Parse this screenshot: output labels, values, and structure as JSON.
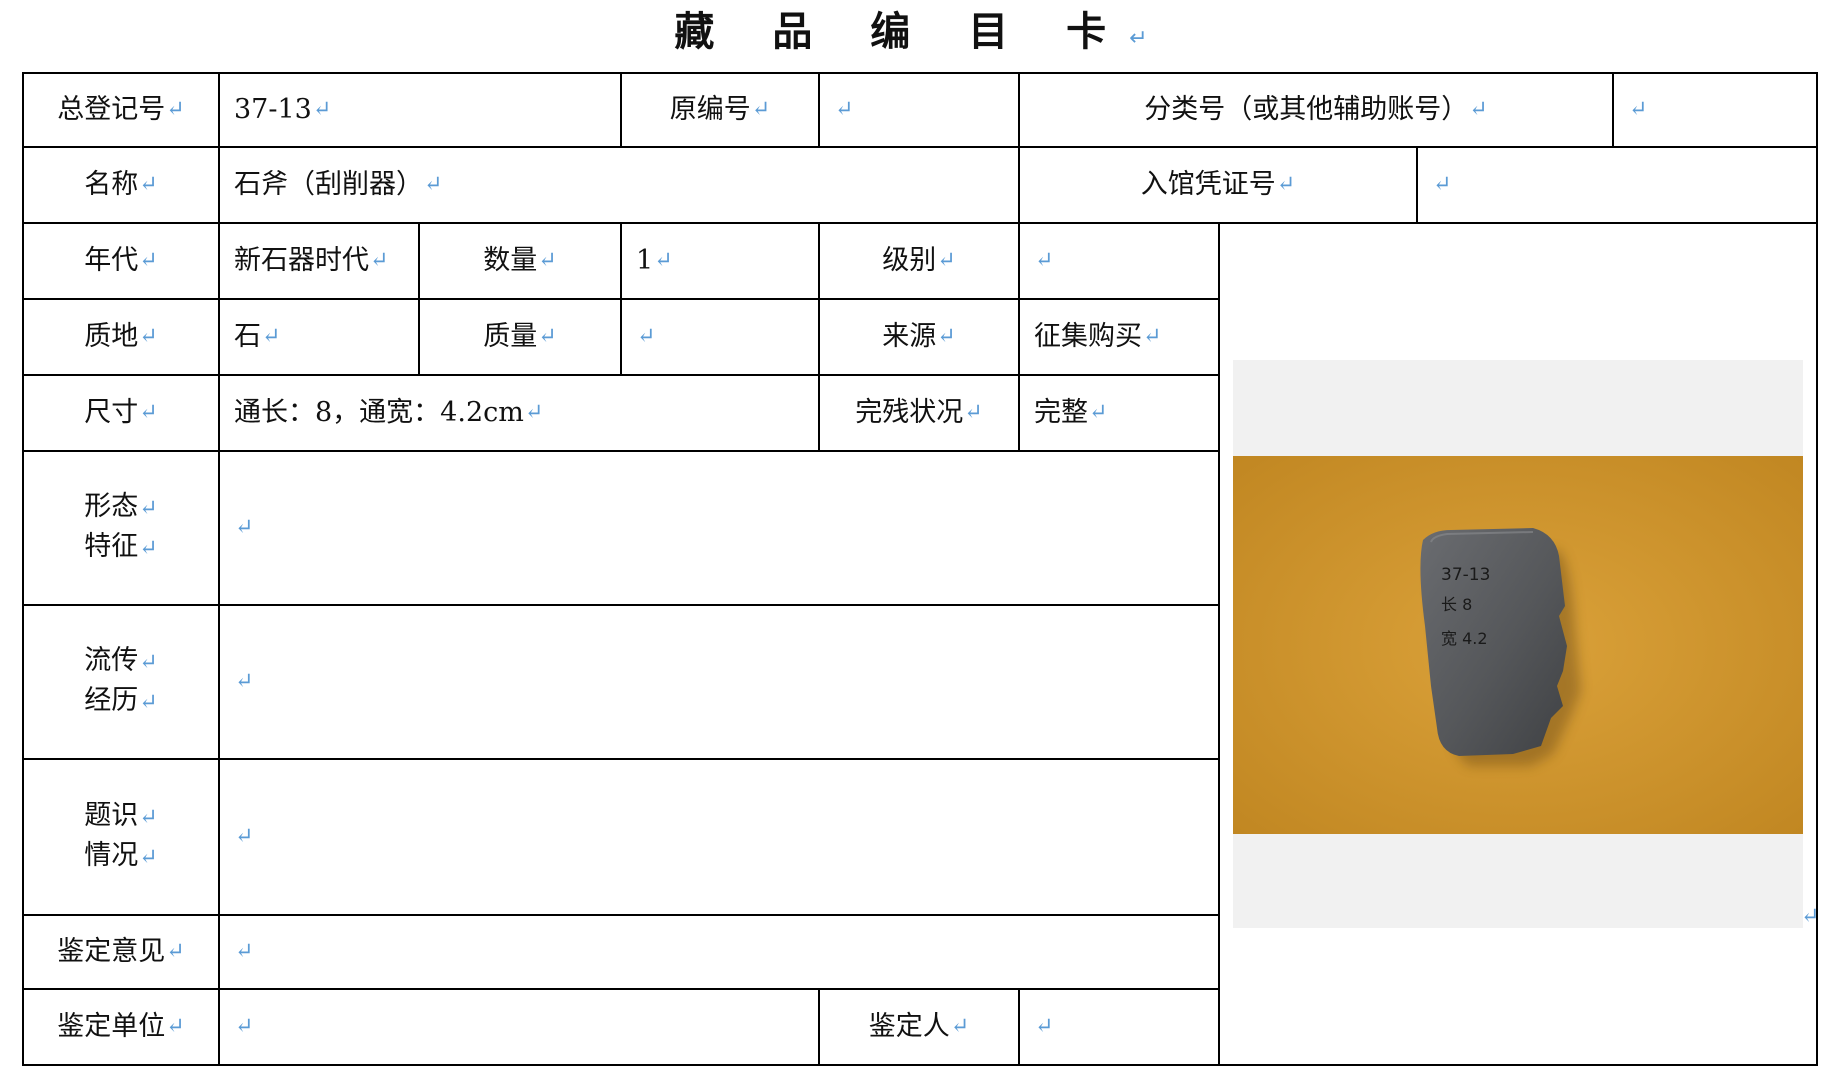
{
  "title": "藏 品 编 目 卡",
  "mark": "↵",
  "rows": {
    "r1": {
      "l1": "总登记号",
      "v1": "37-13",
      "l2": "原编号",
      "v2": "",
      "l3": "分类号（或其他辅助账号）",
      "v3": ""
    },
    "r2": {
      "l1": "名称",
      "v1": "石斧（刮削器）",
      "l2": "入馆凭证号",
      "v2": ""
    },
    "r3": {
      "l1": "年代",
      "v1": "新石器时代",
      "l2": "数量",
      "v2": "1",
      "l3": "级别",
      "v3": ""
    },
    "r4": {
      "l1": "质地",
      "v1": "石",
      "l2": "质量",
      "v2": "",
      "l3": "来源",
      "v3": "征集购买"
    },
    "r5": {
      "l1": "尺寸",
      "v1": "通长：8，通宽：4.2cm",
      "l2": "完残状况",
      "v2": "完整"
    },
    "r6": {
      "l1a": "形态",
      "l1b": "特征",
      "v1": ""
    },
    "r7": {
      "l1a": "流传",
      "l1b": "经历",
      "v1": ""
    },
    "r8": {
      "l1a": "题识",
      "l1b": "情况",
      "v1": ""
    },
    "r9": {
      "l1": "鉴定意见",
      "v1": ""
    },
    "r10": {
      "l1": "鉴定单位",
      "v1": "",
      "l2": "鉴定人",
      "v2": ""
    }
  },
  "photo": {
    "handwriting": [
      "37-13",
      "长 8",
      "宽 4.2"
    ],
    "colors": {
      "background": "#d39a2c",
      "stone": "#55575a",
      "frame": "#f1f1f1"
    }
  }
}
